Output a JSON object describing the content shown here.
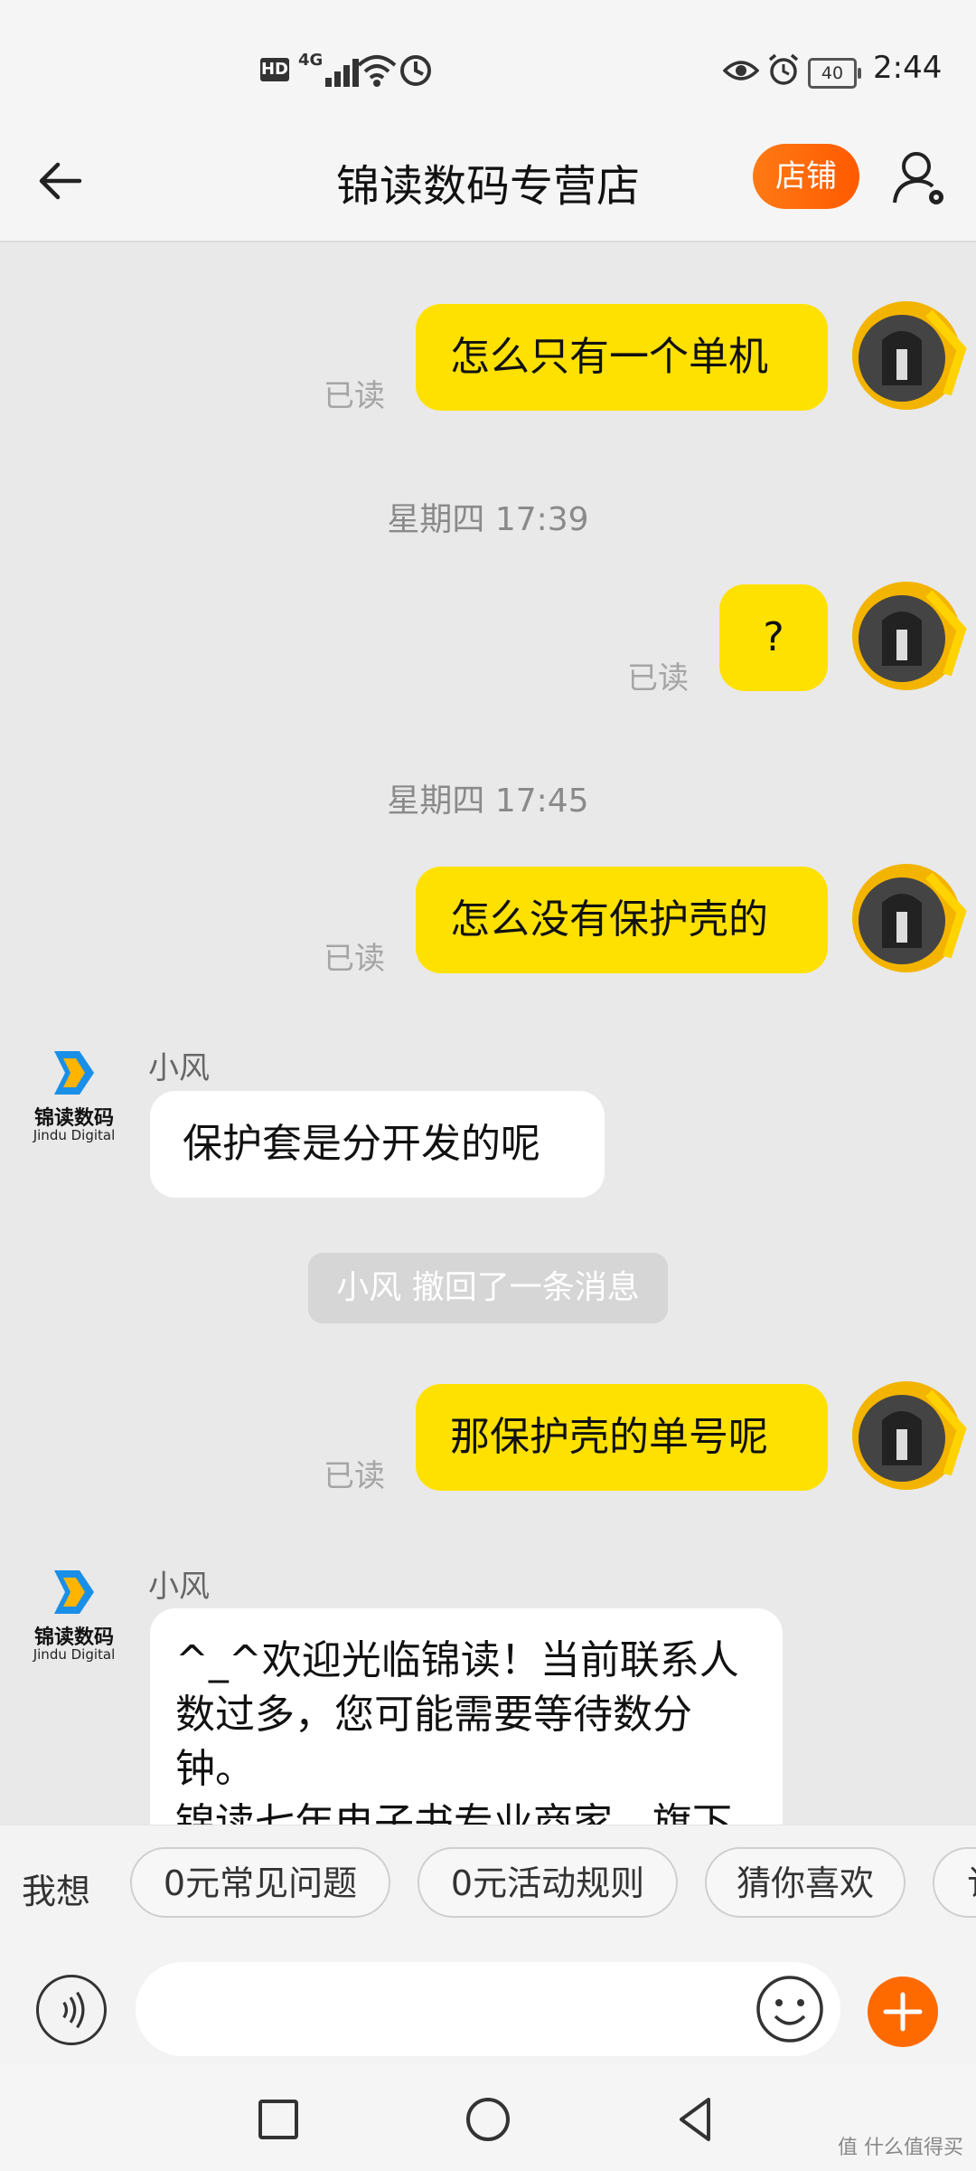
{
  "status_bar": {
    "time": "2:44",
    "network": "4G",
    "battery": "40",
    "hd": "HD"
  },
  "header": {
    "title": "锦读数码专营店",
    "shop_button": "店铺",
    "back_icon": "back-arrow-icon",
    "user_icon": "user-settings-icon"
  },
  "chat": {
    "messages": [
      {
        "text": "怎么只有一个单机",
        "read": "已读"
      },
      {
        "time": "星期四 17:39"
      },
      {
        "text": "?",
        "read": "已读"
      },
      {
        "time": "星期四 17:45"
      },
      {
        "text": "怎么没有保护壳的",
        "read": "已读"
      },
      {
        "sender": "小风",
        "text": "保护套是分开发的呢"
      },
      {
        "system": "小风 撤回了一条消息"
      },
      {
        "text": "那保护壳的单号呢",
        "read": "已读"
      },
      {
        "sender": "小风",
        "text": "^_^欢迎光临锦读！当前联系人数过多，您可能需要等待数分钟。\n锦读七年电子书专业商家，旗下"
      }
    ],
    "shop_logo": {
      "name": "锦读数码",
      "sub": "Jindu Digital"
    }
  },
  "quick_bar": {
    "label": "我想",
    "chips": [
      "0元常见问题",
      "0元活动规则",
      "猜你喜欢",
      "订"
    ]
  },
  "input": {
    "placeholder": ""
  },
  "watermark": "值 什么值得买",
  "colors": {
    "accent": "#ff6a00",
    "bubble_me": "#ffe100",
    "background": "#e9e9e9"
  }
}
